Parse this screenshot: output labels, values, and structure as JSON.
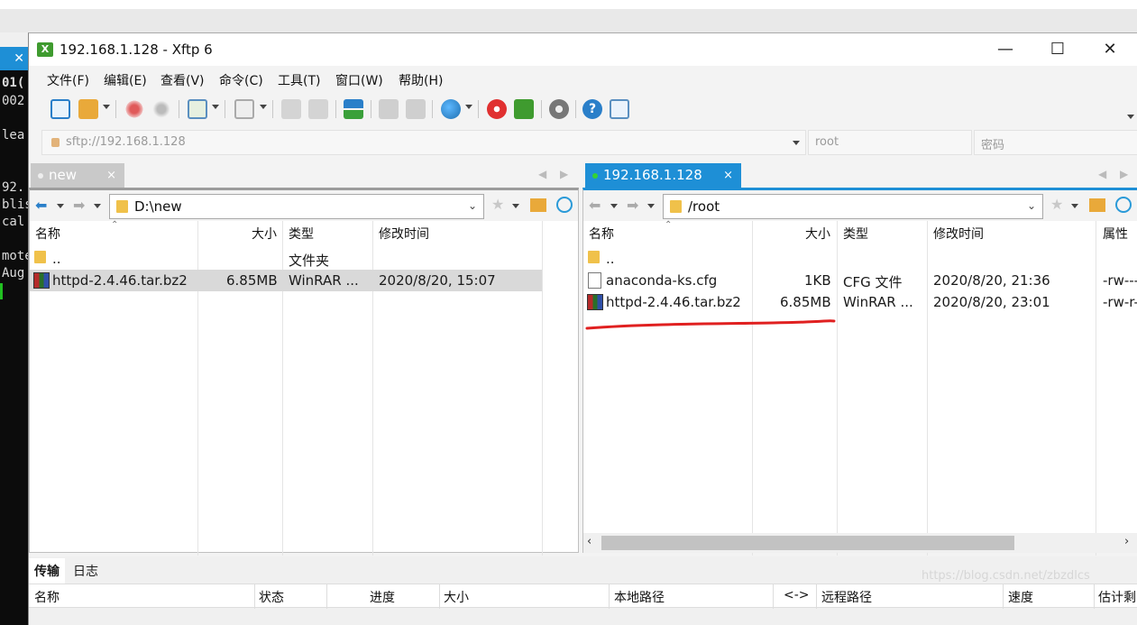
{
  "window": {
    "title": "192.168.1.128 - Xftp 6",
    "minimize": "—",
    "maximize": "☐",
    "close": "✕"
  },
  "menu": [
    "文件(F)",
    "编辑(E)",
    "查看(V)",
    "命令(C)",
    "工具(T)",
    "窗口(W)",
    "帮助(H)"
  ],
  "address": {
    "url": "sftp://192.168.1.128",
    "user_placeholder": "root",
    "password_placeholder": "密码"
  },
  "terminal": {
    "tab_close": "✕",
    "lines": [
      "01(",
      "002",
      "",
      "lea",
      "",
      "",
      "92.",
      "blis",
      "cal",
      "",
      "mote",
      " Aug"
    ]
  },
  "local": {
    "tab": "new",
    "tab_close": "×",
    "path": "D:\\new",
    "columns": [
      "名称",
      "大小",
      "类型",
      "修改时间"
    ],
    "rows": [
      {
        "name": "..",
        "size": "",
        "type": "文件夹",
        "modified": ""
      },
      {
        "name": "httpd-2.4.46.tar.bz2",
        "size": "6.85MB",
        "type": "WinRAR ...",
        "modified": "2020/8/20, 15:07"
      }
    ]
  },
  "remote": {
    "tab": "192.168.1.128",
    "tab_close": "×",
    "path": "/root",
    "columns": [
      "名称",
      "大小",
      "类型",
      "修改时间",
      "属性"
    ],
    "rows": [
      {
        "name": "..",
        "size": "",
        "type": "",
        "modified": "",
        "attr": ""
      },
      {
        "name": "anaconda-ks.cfg",
        "size": "1KB",
        "type": "CFG 文件",
        "modified": "2020/8/20, 21:36",
        "attr": "-rw-----"
      },
      {
        "name": "httpd-2.4.46.tar.bz2",
        "size": "6.85MB",
        "type": "WinRAR ...",
        "modified": "2020/8/20, 23:01",
        "attr": "-rw-r--r"
      }
    ]
  },
  "transfer": {
    "tabs": [
      "传输",
      "日志"
    ],
    "columns": [
      "名称",
      "状态",
      "进度",
      "大小",
      "本地路径",
      "<->",
      "远程路径",
      "速度",
      "估计剩"
    ]
  },
  "watermark": "https://blog.csdn.net/zbzdlcs",
  "colors": {
    "accent": "#1e8fd6",
    "underline": "#e02020"
  }
}
